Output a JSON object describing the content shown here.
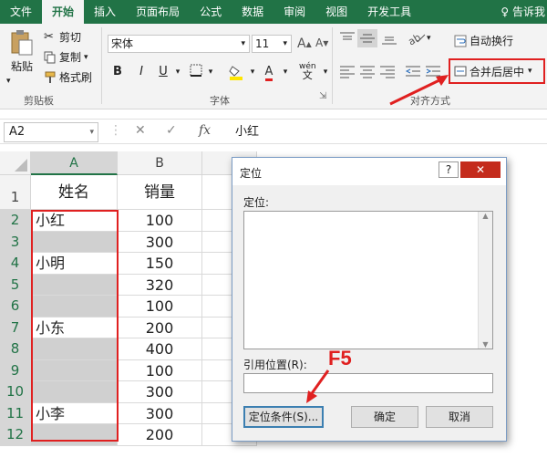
{
  "tabs": [
    "文件",
    "开始",
    "插入",
    "页面布局",
    "公式",
    "数据",
    "审阅",
    "视图",
    "开发工具"
  ],
  "tell_me": "告诉我",
  "clipboard": {
    "paste": "粘贴",
    "cut": "剪切",
    "copy": "复制",
    "format_painter": "格式刷",
    "label": "剪贴板"
  },
  "font": {
    "name": "宋体",
    "size": "11",
    "bold": "B",
    "italic": "I",
    "underline": "U",
    "label": "字体",
    "wen": "wén"
  },
  "align": {
    "wrap": "自动换行",
    "merge": "合并后居中",
    "label": "对齐方式"
  },
  "formula_bar": {
    "name_box": "A2",
    "fx": "fx",
    "value": "小红"
  },
  "columns": [
    "A",
    "B"
  ],
  "rows": [
    {
      "n": "1",
      "a": "姓名",
      "b": "销量",
      "gray": false
    },
    {
      "n": "2",
      "a": "小红",
      "b": "100",
      "gray": false
    },
    {
      "n": "3",
      "a": "",
      "b": "300",
      "gray": true
    },
    {
      "n": "4",
      "a": "小明",
      "b": "150",
      "gray": false
    },
    {
      "n": "5",
      "a": "",
      "b": "320",
      "gray": true
    },
    {
      "n": "6",
      "a": "",
      "b": "100",
      "gray": true
    },
    {
      "n": "7",
      "a": "小东",
      "b": "200",
      "gray": false
    },
    {
      "n": "8",
      "a": "",
      "b": "400",
      "gray": true
    },
    {
      "n": "9",
      "a": "",
      "b": "100",
      "gray": true
    },
    {
      "n": "10",
      "a": "",
      "b": "300",
      "gray": true
    },
    {
      "n": "11",
      "a": "小李",
      "b": "300",
      "gray": false
    },
    {
      "n": "12",
      "a": "",
      "b": "200",
      "gray": true
    }
  ],
  "dialog": {
    "title": "定位",
    "help": "?",
    "goto_label": "定位:",
    "ref_label": "引用位置(R):",
    "special_button": "定位条件(S)...",
    "ok": "确定",
    "cancel": "取消"
  },
  "annotation": {
    "f5": "F5"
  }
}
